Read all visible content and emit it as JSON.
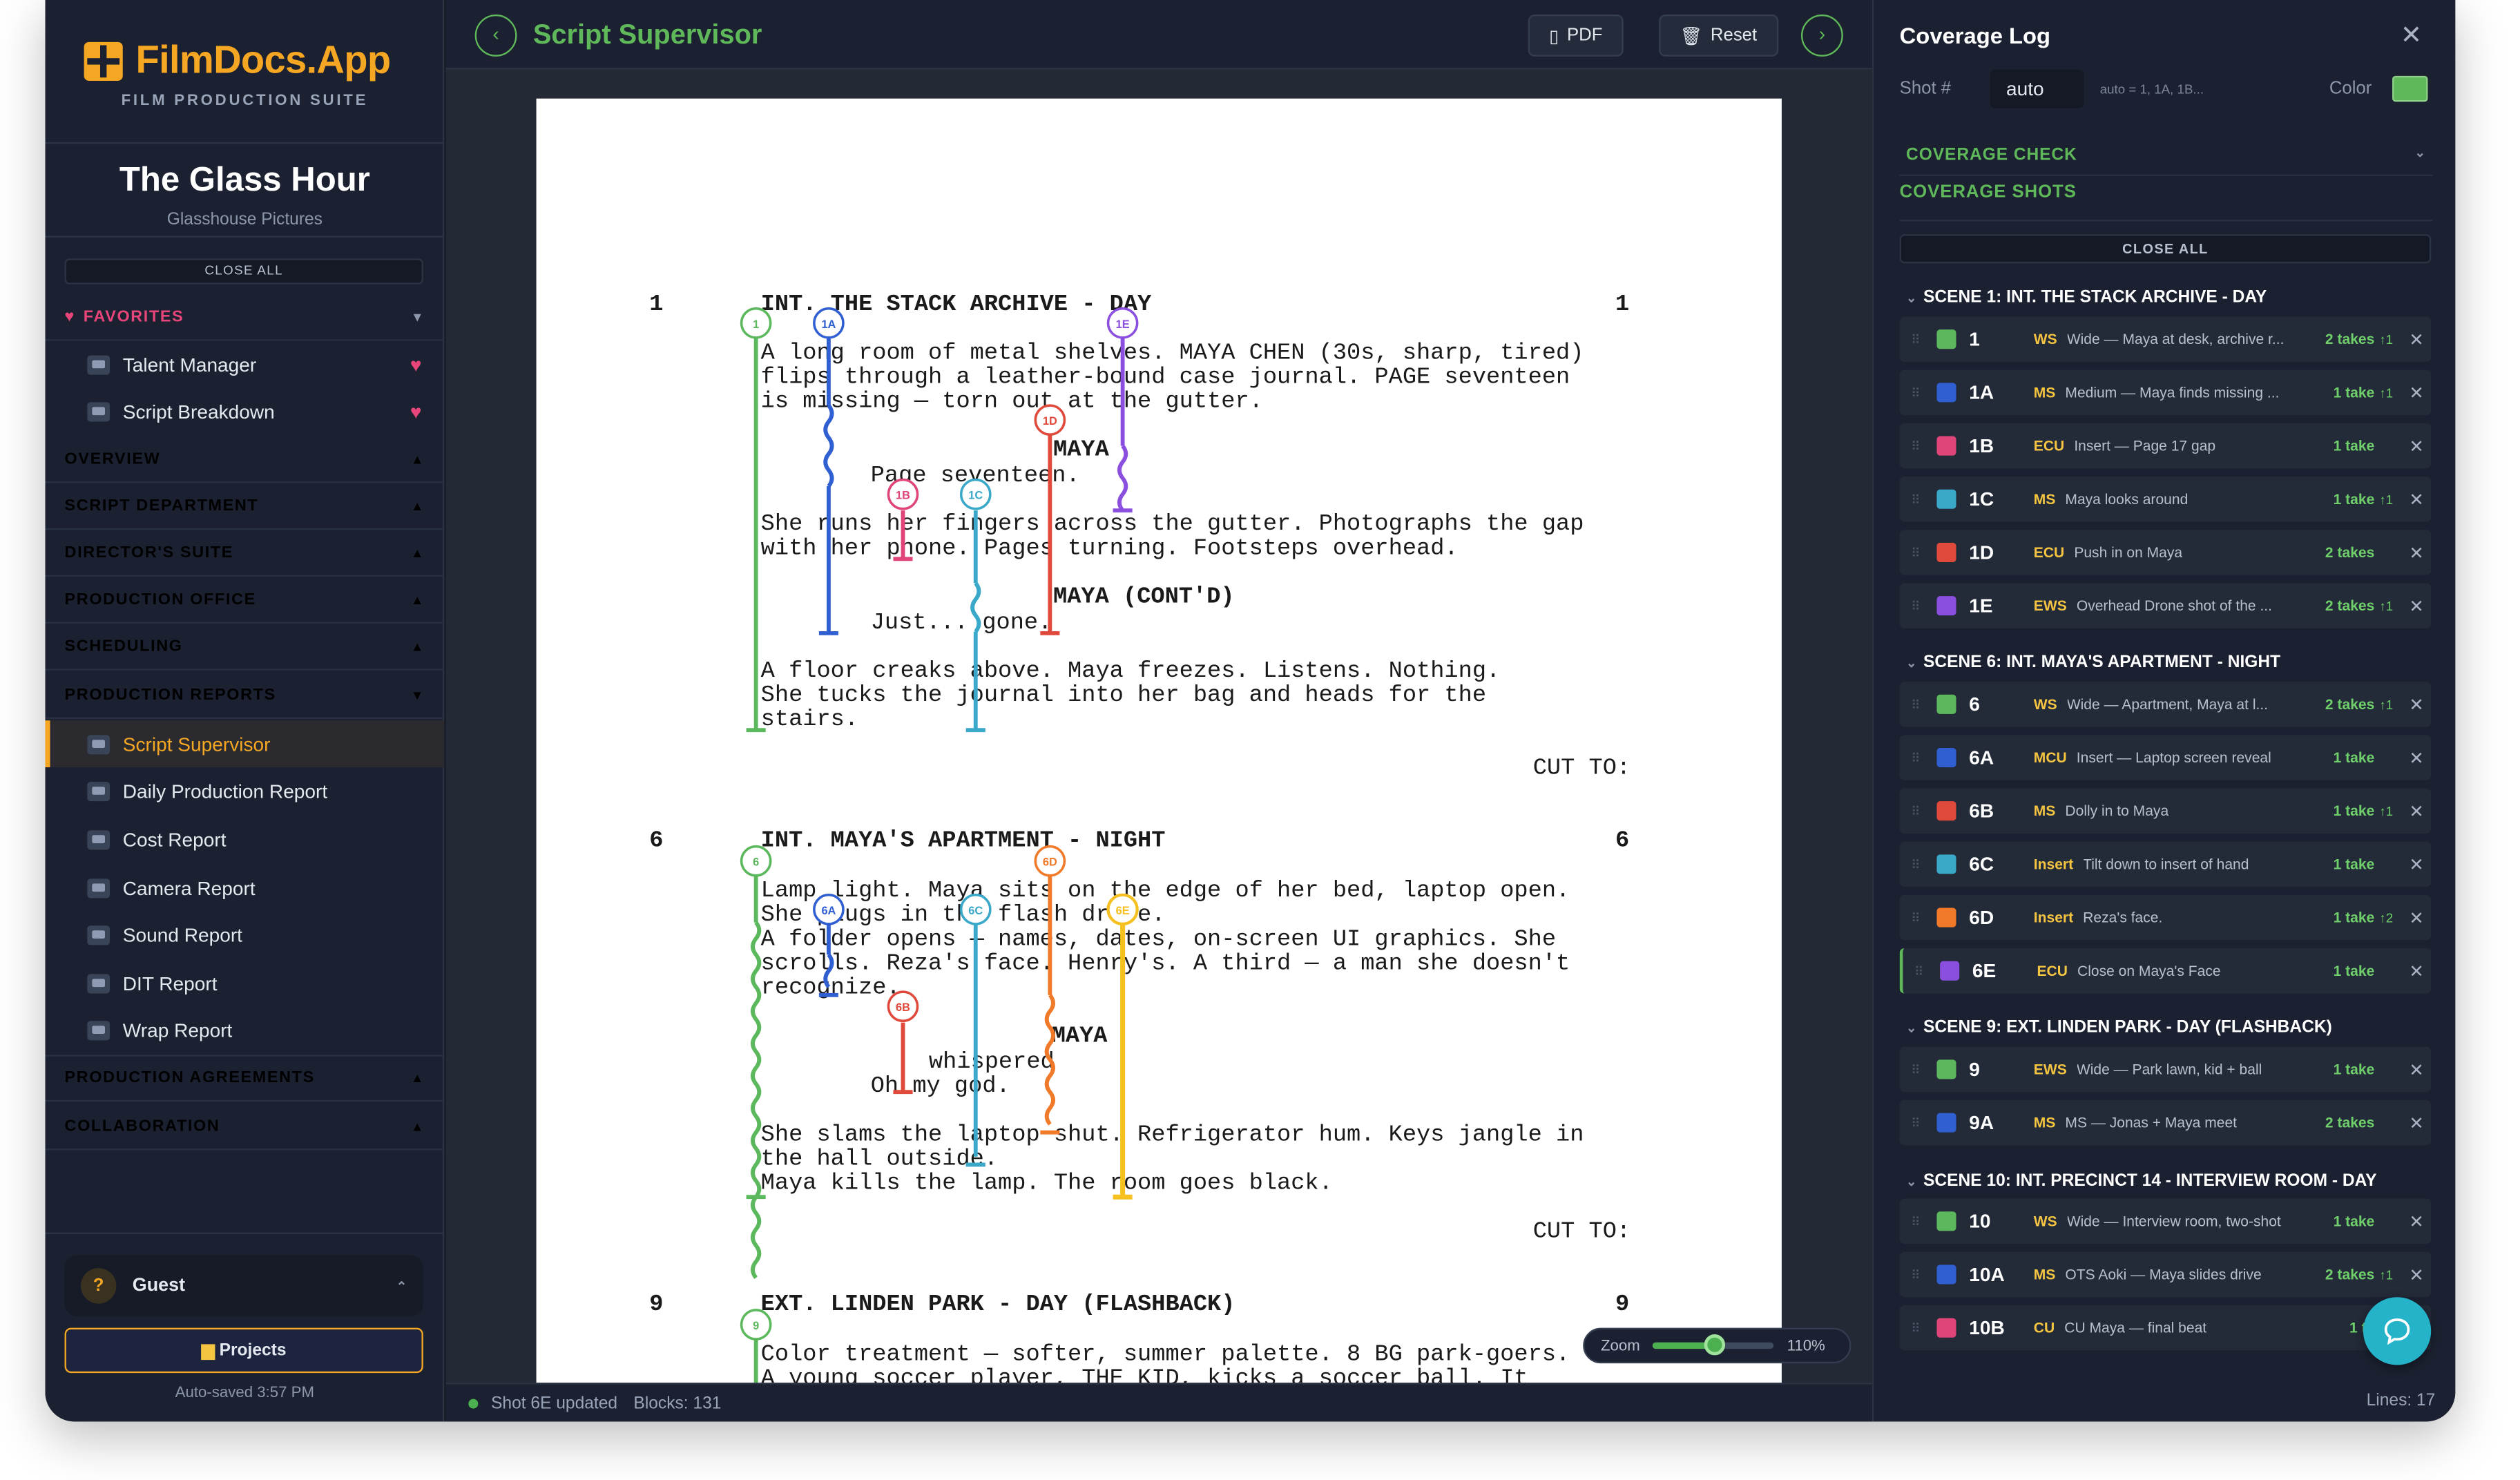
{
  "app": {
    "logo_text": "FilmDocs.App",
    "logo_sub": "FILM PRODUCTION SUITE"
  },
  "project": {
    "title": "The Glass Hour",
    "company": "Glasshouse Pictures"
  },
  "sidebar": {
    "close_all": "CLOSE ALL",
    "favorites": {
      "label": "FAVORITES",
      "items": [
        "Talent Manager",
        "Script Breakdown"
      ]
    },
    "sections": [
      {
        "label": "OVERVIEW",
        "color": "#f5c542"
      },
      {
        "label": "SCRIPT DEPARTMENT",
        "color": "#ef6a6a"
      },
      {
        "label": "DIRECTOR'S SUITE",
        "color": "#9b8cf5"
      },
      {
        "label": "PRODUCTION OFFICE",
        "color": "#4aa8f0"
      },
      {
        "label": "SCHEDULING",
        "color": "#3fc9c0"
      },
      {
        "label": "PRODUCTION REPORTS",
        "color": "#f5a623"
      }
    ],
    "report_items": [
      "Script Supervisor",
      "Daily Production Report",
      "Cost Report",
      "Camera Report",
      "Sound Report",
      "DIT Report",
      "Wrap Report"
    ],
    "sections_after": [
      {
        "label": "PRODUCTION AGREEMENTS",
        "color": "#5fd06a"
      },
      {
        "label": "COLLABORATION",
        "color": "#3fc9e8"
      }
    ],
    "guest": {
      "initial": "?",
      "name": "Guest"
    },
    "projects_button": "Projects",
    "autosave": "Auto-saved 3:57 PM"
  },
  "toolbar": {
    "title": "Script Supervisor",
    "pdf": "PDF",
    "reset": "Reset"
  },
  "script": {
    "scenes": [
      {
        "number": "1",
        "heading": "INT. THE STACK ARCHIVE - DAY"
      },
      {
        "number": "6",
        "heading": "INT. MAYA'S APARTMENT - NIGHT"
      },
      {
        "number": "9",
        "heading": "EXT. LINDEN PARK - DAY (FLASHBACK)"
      }
    ],
    "lines": [
      "A long room of metal shelves. MAYA CHEN (30s, sharp, tired)",
      "flips through a leather-bound case journal. PAGE seventeen",
      "is missing — torn out at the gutter.",
      "MAYA",
      "Page seventeen.",
      "She runs her fingers across the gutter. Photographs the gap",
      "with her phone. Pages turning. Footsteps overhead.",
      "MAYA (CONT'D)",
      "Just... gone.",
      "A floor creaks above. Maya freezes. Listens. Nothing.",
      "She tucks the journal into her bag and heads for the",
      "stairs.",
      "CUT TO:",
      "Lamp light. Maya sits on the edge of her bed, laptop open.",
      "She plugs in the flash drive.",
      "A folder opens — names, dates, on-screen UI graphics. She",
      "scrolls. Reza's face. Henry's. A third — a man she doesn't",
      "recognize.",
      "MAYA",
      "whispered",
      "Oh my god.",
      "She slams the laptop shut. Refrigerator hum. Keys jangle in",
      "the hall outside.",
      "Maya kills the lamp. The room goes black.",
      "CUT TO:",
      "Color treatment — softer, summer palette. 8 BG park-goers.",
      "A young soccer player, THE KID, kicks a soccer ball. It"
    ],
    "markers": [
      "1",
      "1A",
      "1B",
      "1C",
      "1D",
      "1E",
      "6",
      "6A",
      "6B",
      "6C",
      "6D",
      "6E",
      "9"
    ],
    "marker_colors": {
      "green": "#5cb85c",
      "blue": "#2f5fd0",
      "pink": "#e0457a",
      "cyan": "#3aa8c9",
      "red": "#e04a3c",
      "purple": "#8b4fe0",
      "orange": "#f07a2a",
      "yellow": "#f5c020"
    }
  },
  "status": {
    "text": "Shot 6E updated",
    "blocks": "Blocks: 131"
  },
  "zoom": {
    "label": "Zoom",
    "value": "110%",
    "level_fraction": 0.5
  },
  "coverage": {
    "title": "Coverage Log",
    "shot_label": "Shot #",
    "shot_value": "auto",
    "shot_hint": "auto = 1, 1A, 1B...",
    "color_label": "Color",
    "check": "COVERAGE CHECK",
    "shots_heading": "COVERAGE SHOTS",
    "close_all": "CLOSE ALL",
    "groups": [
      {
        "title": "SCENE 1: INT. THE STACK ARCHIVE - DAY",
        "shots": [
          {
            "num": "1",
            "color": "#5cb85c",
            "type": "WS",
            "desc": "Wide — Maya at desk, archive r...",
            "takes": "2 takes",
            "ver": "↑1"
          },
          {
            "num": "1A",
            "color": "#2f5fd0",
            "type": "MS",
            "desc": "Medium — Maya finds missing ...",
            "takes": "1 take",
            "ver": "↑1"
          },
          {
            "num": "1B",
            "color": "#e0457a",
            "type": "ECU",
            "desc": "Insert — Page 17 gap",
            "takes": "1 take",
            "ver": ""
          },
          {
            "num": "1C",
            "color": "#3aa8c9",
            "type": "MS",
            "desc": "Maya looks around",
            "takes": "1 take",
            "ver": "↑1"
          },
          {
            "num": "1D",
            "color": "#e04a3c",
            "type": "ECU",
            "desc": "Push in on Maya",
            "takes": "2 takes",
            "ver": ""
          },
          {
            "num": "1E",
            "color": "#8b4fe0",
            "type": "EWS",
            "desc": "Overhead Drone shot of the ...",
            "takes": "2 takes",
            "ver": "↑1"
          }
        ]
      },
      {
        "title": "SCENE 6: INT. MAYA'S APARTMENT - NIGHT",
        "shots": [
          {
            "num": "6",
            "color": "#5cb85c",
            "type": "WS",
            "desc": "Wide — Apartment, Maya at l...",
            "takes": "2 takes",
            "ver": "↑1"
          },
          {
            "num": "6A",
            "color": "#2f5fd0",
            "type": "MCU",
            "desc": "Insert — Laptop screen reveal",
            "takes": "1 take",
            "ver": ""
          },
          {
            "num": "6B",
            "color": "#e04a3c",
            "type": "MS",
            "desc": "Dolly in to Maya",
            "takes": "1 take",
            "ver": "↑1"
          },
          {
            "num": "6C",
            "color": "#3aa8c9",
            "type": "Insert",
            "desc": "Tilt down to insert of hand",
            "takes": "1 take",
            "ver": ""
          },
          {
            "num": "6D",
            "color": "#f07a2a",
            "type": "Insert",
            "desc": "Reza's face.",
            "takes": "1 take",
            "ver": "↑2"
          },
          {
            "num": "6E",
            "color": "#8b4fe0",
            "type": "ECU",
            "desc": "Close on Maya's Face",
            "takes": "1 take",
            "ver": ""
          }
        ]
      },
      {
        "title": "SCENE 9: EXT. LINDEN PARK - DAY (FLASHBACK)",
        "shots": [
          {
            "num": "9",
            "color": "#5cb85c",
            "type": "EWS",
            "desc": "Wide — Park lawn, kid + ball",
            "takes": "1 take",
            "ver": ""
          },
          {
            "num": "9A",
            "color": "#2f5fd0",
            "type": "MS",
            "desc": "MS — Jonas + Maya meet",
            "takes": "2 takes",
            "ver": ""
          }
        ]
      },
      {
        "title": "SCENE 10: INT. PRECINCT 14 - INTERVIEW ROOM - DAY",
        "shots": [
          {
            "num": "10",
            "color": "#5cb85c",
            "type": "WS",
            "desc": "Wide — Interview room, two-shot",
            "takes": "1 take",
            "ver": ""
          },
          {
            "num": "10A",
            "color": "#2f5fd0",
            "type": "MS",
            "desc": "OTS Aoki — Maya slides drive",
            "takes": "2 takes",
            "ver": "↑1"
          },
          {
            "num": "10B",
            "color": "#e0457a",
            "type": "CU",
            "desc": "CU Maya — final beat",
            "takes": "1 ta",
            "ver": ""
          }
        ]
      }
    ],
    "lines_count": "Lines: 17"
  }
}
